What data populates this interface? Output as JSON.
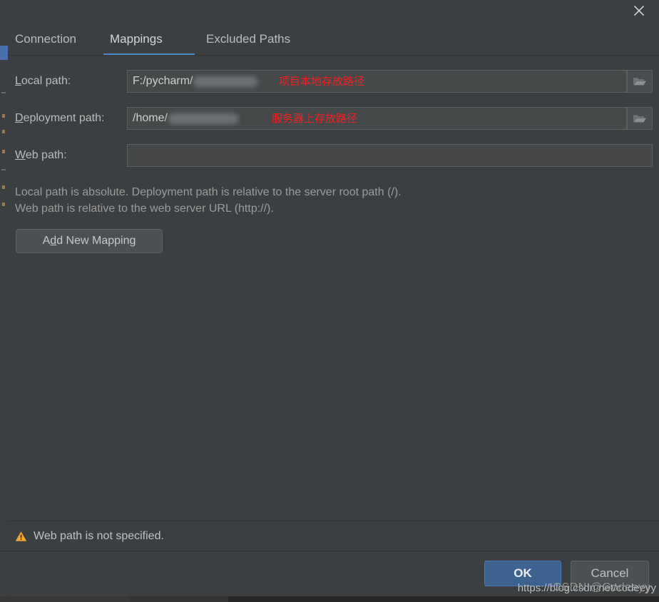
{
  "window": {
    "close_icon": "close-icon"
  },
  "tabs": [
    {
      "label": "Connection",
      "active": false
    },
    {
      "label": "Mappings",
      "active": true
    },
    {
      "label": "Excluded Paths",
      "active": false
    }
  ],
  "form": {
    "rows": [
      {
        "label_mnemonic": "L",
        "label_rest": "ocal path:",
        "value": "F:/pycharm/",
        "redacted": true,
        "annotation": "项目本地存放路径",
        "browse": true,
        "browse_icon": "folder-icon"
      },
      {
        "label_mnemonic": "D",
        "label_rest": "eployment path:",
        "value": "/home/",
        "redacted": true,
        "annotation": "服务器上存放路径",
        "browse": true,
        "browse_icon": "folder-icon"
      },
      {
        "label_mnemonic": "W",
        "label_rest": "eb path:",
        "value": "",
        "redacted": false,
        "annotation": "",
        "browse": false,
        "browse_icon": ""
      }
    ],
    "hint_line_1": "Local path is absolute. Deployment path is relative to the server root path (/).",
    "hint_line_2": "Web path is relative to the web server URL (http://).",
    "add_button": {
      "prefix": "A",
      "mnemonic": "d",
      "suffix": "d New Mapping"
    }
  },
  "status": {
    "icon": "warning-triangle-icon",
    "message": "Web path is not specified."
  },
  "buttons": {
    "ok": "OK",
    "cancel": "Cancel"
  },
  "watermark": {
    "line_a": "https://blog.csdn.net/codeeyy",
    "line_b": "CSDN @Godeeyy"
  },
  "colors": {
    "window_bg": "#3c3f41",
    "tab_accent": "#4a88c7",
    "field_bg": "#45494a",
    "annotation_red": "#f02020",
    "ok_button": "#3c638f",
    "warning_amber": "#f0a732"
  }
}
